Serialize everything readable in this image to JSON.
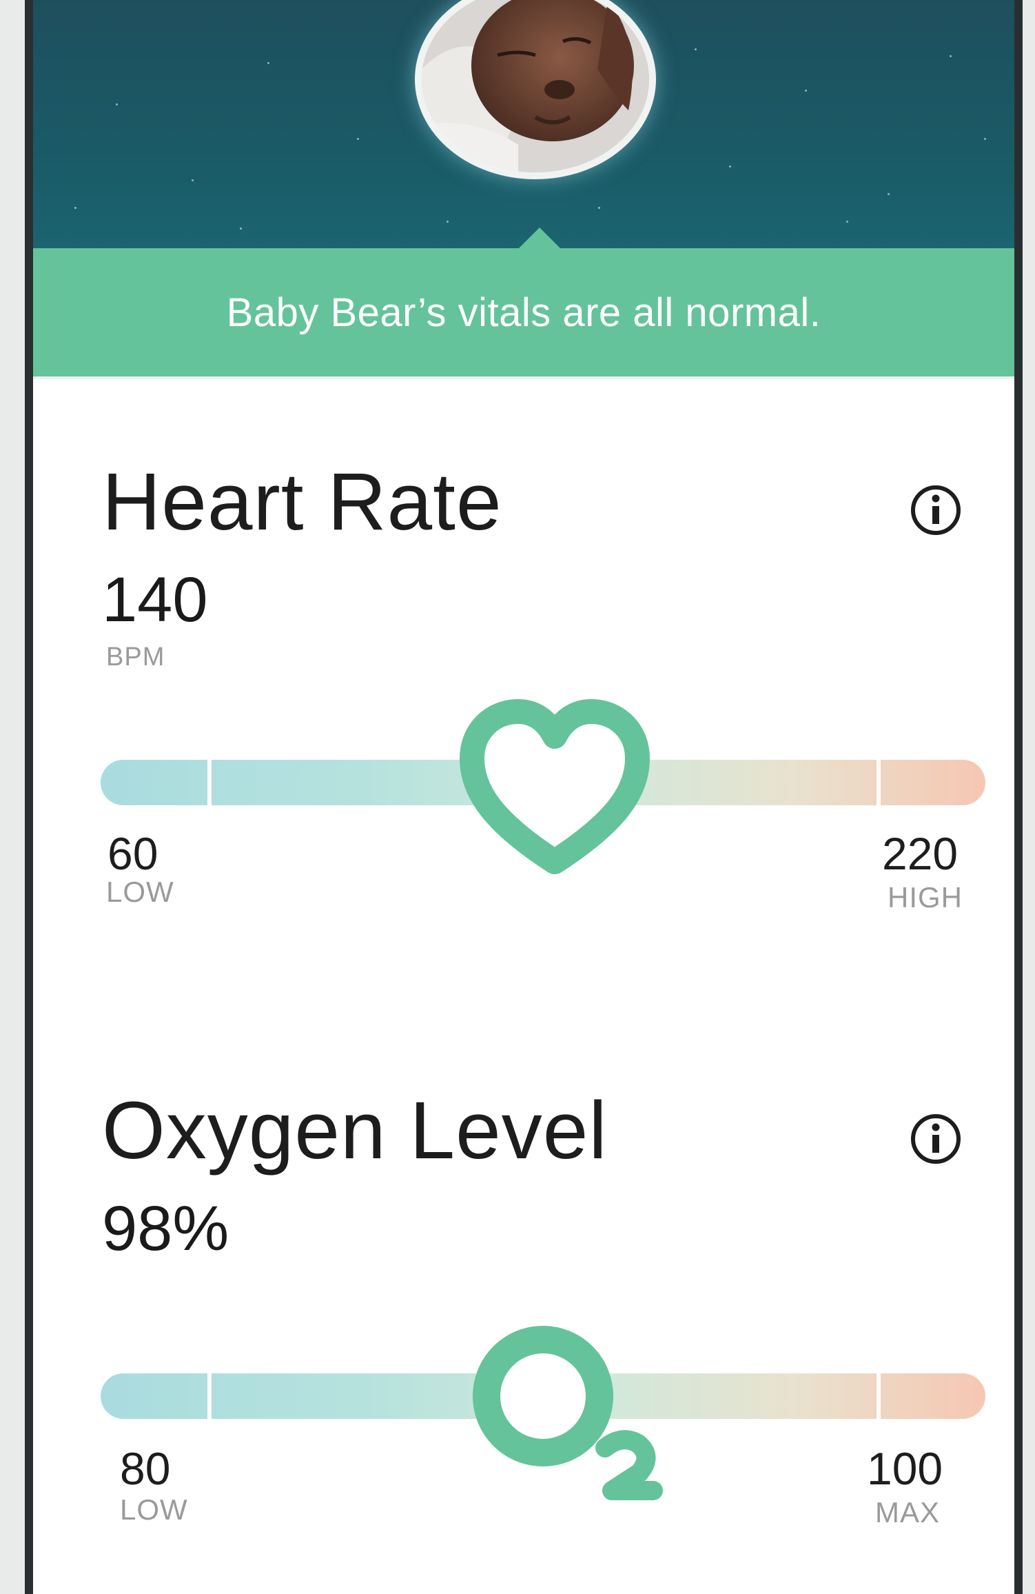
{
  "status": {
    "message": "Baby Bear’s vitals are all normal."
  },
  "heart_rate": {
    "title": "Heart Rate",
    "value": "140",
    "unit": "BPM",
    "low_value": "60",
    "low_label": "LOW",
    "high_value": "220",
    "high_label": "HIGH",
    "marker_icon": "heart-icon"
  },
  "oxygen_level": {
    "title": "Oxygen Level",
    "value": "98%",
    "low_value": "80",
    "low_label": "LOW",
    "high_value": "100",
    "high_label": "MAX",
    "marker_icon": "o2-icon"
  },
  "colors": {
    "header_dark": "#1e4f5d",
    "status_green": "#64c39a",
    "accent_green": "#64c39a",
    "gauge_cool": "#a9dcdf",
    "gauge_warm": "#f6c7b2"
  }
}
